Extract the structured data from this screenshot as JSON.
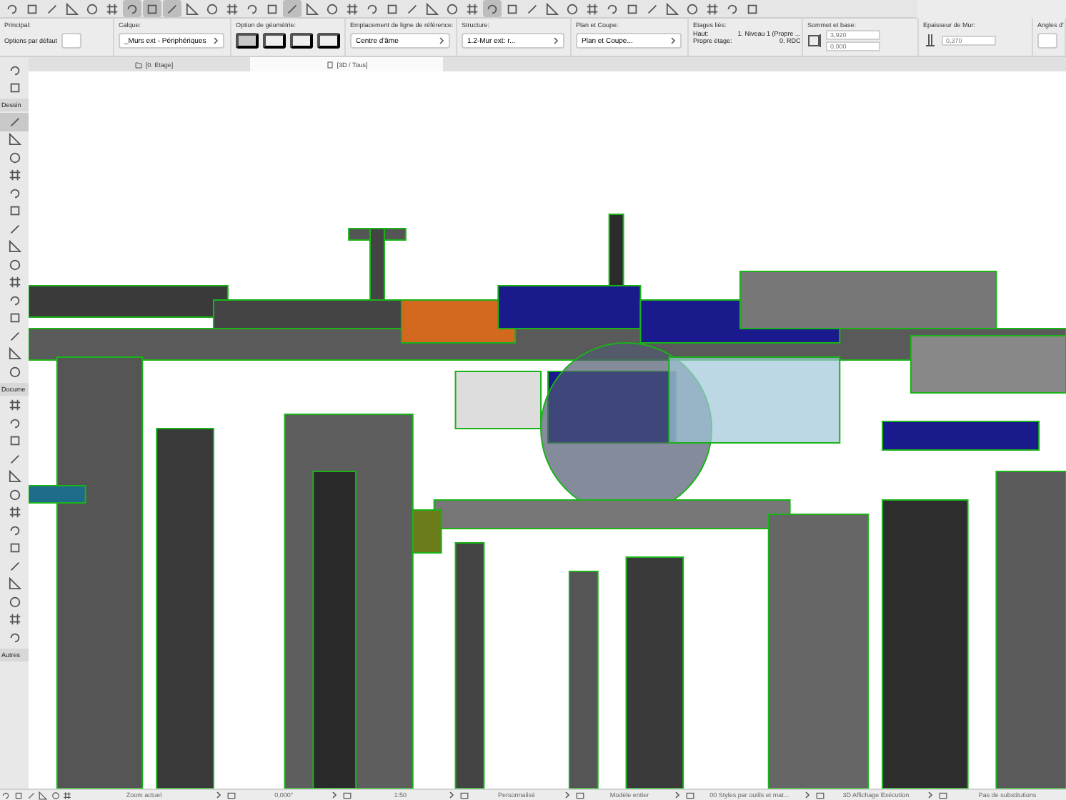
{
  "toolbar": {
    "buttons": [
      {
        "selected": false
      },
      {
        "selected": false
      },
      {
        "selected": false
      },
      {
        "selected": false
      },
      {
        "selected": false
      },
      {
        "selected": false
      },
      {
        "selected": true
      },
      {
        "selected": true
      },
      {
        "selected": true
      },
      {
        "selected": false
      },
      {
        "selected": false
      },
      {
        "selected": false
      },
      {
        "selected": false
      },
      {
        "selected": false
      },
      {
        "selected": true
      },
      {
        "selected": false
      },
      {
        "selected": false
      },
      {
        "selected": false
      },
      {
        "selected": false
      },
      {
        "selected": false
      },
      {
        "selected": false
      },
      {
        "selected": false
      },
      {
        "selected": false
      },
      {
        "selected": false
      },
      {
        "selected": true
      },
      {
        "selected": false
      },
      {
        "selected": false
      },
      {
        "selected": false
      },
      {
        "selected": false
      },
      {
        "selected": false
      },
      {
        "selected": false
      },
      {
        "selected": false
      },
      {
        "selected": false
      },
      {
        "selected": false
      },
      {
        "selected": false
      },
      {
        "selected": false
      },
      {
        "selected": false
      },
      {
        "selected": false
      }
    ]
  },
  "info_box": [
    {
      "kind": "button",
      "label": "Principal:",
      "caption": "Options par défaut"
    },
    {
      "kind": "field",
      "label": "Calque:",
      "value": "_Murs ext - Périphériques"
    },
    {
      "kind": "icons",
      "label": "Option de géométrie:"
    },
    {
      "kind": "field",
      "label": "Emplacement de ligne de référence:",
      "value": "Centre d'âme"
    },
    {
      "kind": "field",
      "label": "Structure:",
      "value": "1.2-Mur ext: r..."
    },
    {
      "kind": "field",
      "label": "Plan et Coupe:",
      "value": "Plan et Coupe..."
    },
    {
      "kind": "stories",
      "label": "Etages liés:",
      "top_label": "Haut:",
      "top_value": "1. Niveau 1 (Propre ...",
      "home_label": "Propre étage:",
      "home_value": "0. RDC"
    },
    {
      "kind": "heights",
      "label": "Sommet et base:",
      "values": [
        "3,920",
        "0,000"
      ]
    },
    {
      "kind": "thickness",
      "label": "Epaisseur de Mur:",
      "value": "0,370"
    },
    {
      "kind": "cut",
      "label": "Angles d'"
    }
  ],
  "tabs": [
    {
      "label": "[0. Etage]",
      "selected": false
    },
    {
      "label": "[3D / Tous]",
      "selected": true
    }
  ],
  "toolbox": [
    {
      "kind": "tool",
      "selected": false
    },
    {
      "kind": "tool",
      "selected": false
    },
    {
      "kind": "header",
      "label": "Dessin"
    },
    {
      "kind": "tool",
      "selected": true
    },
    {
      "kind": "tool",
      "selected": false
    },
    {
      "kind": "tool",
      "selected": false
    },
    {
      "kind": "tool",
      "selected": false
    },
    {
      "kind": "tool",
      "selected": false
    },
    {
      "kind": "tool",
      "selected": false
    },
    {
      "kind": "tool",
      "selected": false
    },
    {
      "kind": "tool",
      "selected": false
    },
    {
      "kind": "tool",
      "selected": false
    },
    {
      "kind": "tool",
      "selected": false
    },
    {
      "kind": "tool",
      "selected": false
    },
    {
      "kind": "tool",
      "selected": false
    },
    {
      "kind": "tool",
      "selected": false
    },
    {
      "kind": "tool",
      "selected": false
    },
    {
      "kind": "tool",
      "selected": false
    },
    {
      "kind": "header",
      "label": "Docume"
    },
    {
      "kind": "tool",
      "selected": false
    },
    {
      "kind": "tool",
      "selected": false
    },
    {
      "kind": "tool",
      "selected": false
    },
    {
      "kind": "tool",
      "selected": false
    },
    {
      "kind": "tool",
      "selected": false
    },
    {
      "kind": "tool",
      "selected": false
    },
    {
      "kind": "tool",
      "selected": false
    },
    {
      "kind": "tool",
      "selected": false
    },
    {
      "kind": "tool",
      "selected": false
    },
    {
      "kind": "tool",
      "selected": false
    },
    {
      "kind": "tool",
      "selected": false
    },
    {
      "kind": "tool",
      "selected": false
    },
    {
      "kind": "tool",
      "selected": false
    },
    {
      "kind": "tool",
      "selected": false
    },
    {
      "kind": "header",
      "label": "Autres"
    }
  ],
  "status_bar": [
    "Zoom actuel",
    "0,000°",
    "1:50",
    "Personnalisé",
    "Modèle entier",
    "00 Styles par outils et mat...",
    "3D Affichage Exécution",
    "Pas de substitutions"
  ]
}
